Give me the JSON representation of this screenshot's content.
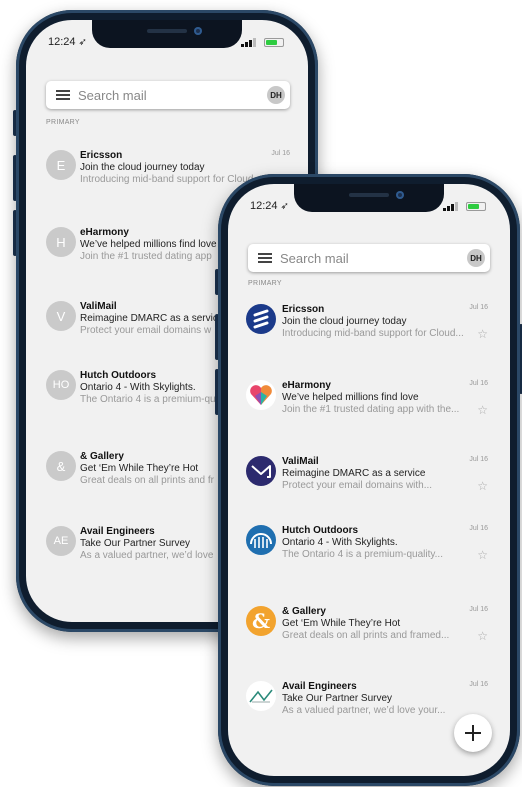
{
  "status_bar": {
    "time": "12:24",
    "location_icon": "location-arrow-icon"
  },
  "search": {
    "placeholder": "Search mail",
    "account_initials": "DH"
  },
  "section_label": "PRIMARY",
  "fab": {
    "icon": "plus-icon"
  },
  "back_phone": {
    "emails": [
      {
        "avatar": "E",
        "sender": "Ericsson",
        "subject": "Join the cloud journey today",
        "preview": "Introducing mid-band support for Cloud",
        "date": "Jul 16"
      },
      {
        "avatar": "H",
        "sender": "eHarmony",
        "subject": "We’ve helped millions find love",
        "preview": "Join the #1 trusted dating app"
      },
      {
        "avatar": "V",
        "sender": "ValiMail",
        "subject": "Reimagine DMARC as a service",
        "preview": "Protect your email domains w"
      },
      {
        "avatar": "HO",
        "sender": "Hutch Outdoors",
        "subject": "Ontario 4 - With Skylights.",
        "preview": "The Ontario 4 is a premium-qu"
      },
      {
        "avatar": "&",
        "sender": "& Gallery",
        "subject": "Get ‘Em While They’re Hot",
        "preview": "Great deals on all prints and fr"
      },
      {
        "avatar": "AE",
        "sender": "Avail Engineers",
        "subject": "Take Our Partner Survey",
        "preview": "As a valued partner, we’d love"
      }
    ]
  },
  "front_phone": {
    "emails": [
      {
        "sender": "Ericsson",
        "subject": "Join the cloud journey today",
        "preview": "Introducing mid-band support for Cloud...",
        "date": "Jul 16",
        "logo": "ericsson-logo-icon"
      },
      {
        "sender": "eHarmony",
        "subject": "We’ve helped millions find love",
        "preview": "Join the #1 trusted dating app with the...",
        "date": "Jul 16",
        "logo": "eharmony-heart-logo-icon"
      },
      {
        "sender": "ValiMail",
        "subject": "Reimagine DMARC as a service",
        "preview": "Protect your email domains with...",
        "date": "Jul 16",
        "logo": "valimail-envelope-logo-icon"
      },
      {
        "sender": "Hutch Outdoors",
        "subject": "Ontario 4 - With Skylights.",
        "preview": "The Ontario 4 is a premium-quality...",
        "date": "Jul 16",
        "logo": "hutch-tent-logo-icon"
      },
      {
        "sender": "& Gallery",
        "subject": "Get ‘Em While They’re Hot",
        "preview": "Great deals on all prints and framed...",
        "date": "Jul 16",
        "logo": "gallery-ampersand-logo-icon"
      },
      {
        "sender": "Avail Engineers",
        "subject": "Take Our Partner Survey",
        "preview": "As a valued partner, we’d love your...",
        "date": "Jul 16",
        "logo": "avail-engineers-logo-icon"
      }
    ]
  },
  "colors": {
    "frame": "#0f1d2e",
    "screen": "#f1f1f1",
    "ericsson": "#1b3a8a",
    "valimail": "#2c2a6e",
    "hutch": "#1f6fb0",
    "gallery": "#f2a32e"
  }
}
